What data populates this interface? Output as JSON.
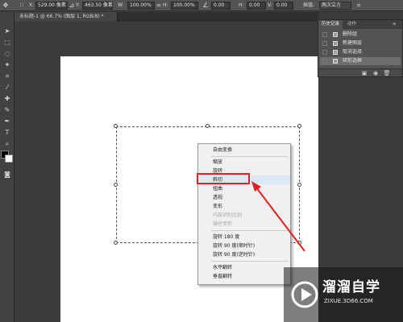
{
  "options_bar": {
    "x_label": "X:",
    "x_value": "529.00 像素",
    "y_label": "Y:",
    "y_value": "463.50 像素",
    "w_label": "W:",
    "w_value": "100.00%",
    "h_label": "H:",
    "h_value": "100.00%",
    "angle_value": "0.00",
    "h_skew_label": "H:",
    "h_skew_value": "0.00",
    "v_skew_label": "V:",
    "v_skew_value": "0.00",
    "interp_label": "插值:",
    "interp_value": "两次立方"
  },
  "document_tab": {
    "title": "未标题-1 @ 66.7% (图层 1, RGB/8) *"
  },
  "context_menu": {
    "groups": [
      [
        "自由变换"
      ],
      [
        "缩放",
        "旋转",
        "斜切",
        "扭曲",
        "透视",
        "变形",
        "内容识别比例",
        "操控变形"
      ],
      [
        "旋转 180 度",
        "旋转 90 度(顺时针)",
        "旋转 90 度(逆时针)"
      ],
      [
        "水平翻转",
        "垂直翻转"
      ]
    ],
    "items": {
      "free_transform": "自由变换",
      "scale": "缩放",
      "rotate": "旋转",
      "skew": "斜切",
      "distort": "扭曲",
      "perspective": "透视",
      "warp": "变形",
      "content_aware_scale": "内容识别比例",
      "puppet_warp": "操控变形",
      "rotate_180": "旋转 180 度",
      "rotate_90_cw": "旋转 90 度(顺时针)",
      "rotate_90_ccw": "旋转 90 度(逆时针)",
      "flip_h": "水平翻转",
      "flip_v": "垂直翻转"
    },
    "disabled_items": [
      "内容识别比例",
      "操控变形"
    ],
    "highlighted_item": "斜切",
    "annotation_color": "#e02020"
  },
  "history_panel": {
    "tabs": [
      "历史记录",
      "动作"
    ],
    "active_tab": "历史记录",
    "rows": [
      "删除组",
      "新建图层",
      "取消选择",
      "矩形选框"
    ],
    "active_row": "矩形选框"
  },
  "watermark": {
    "title": "溜溜自学",
    "url": "ZIXUE.3D66.COM"
  },
  "colors": {
    "foreground": "#000000",
    "background": "#ffffff",
    "workspace": "#3b3b3b"
  }
}
